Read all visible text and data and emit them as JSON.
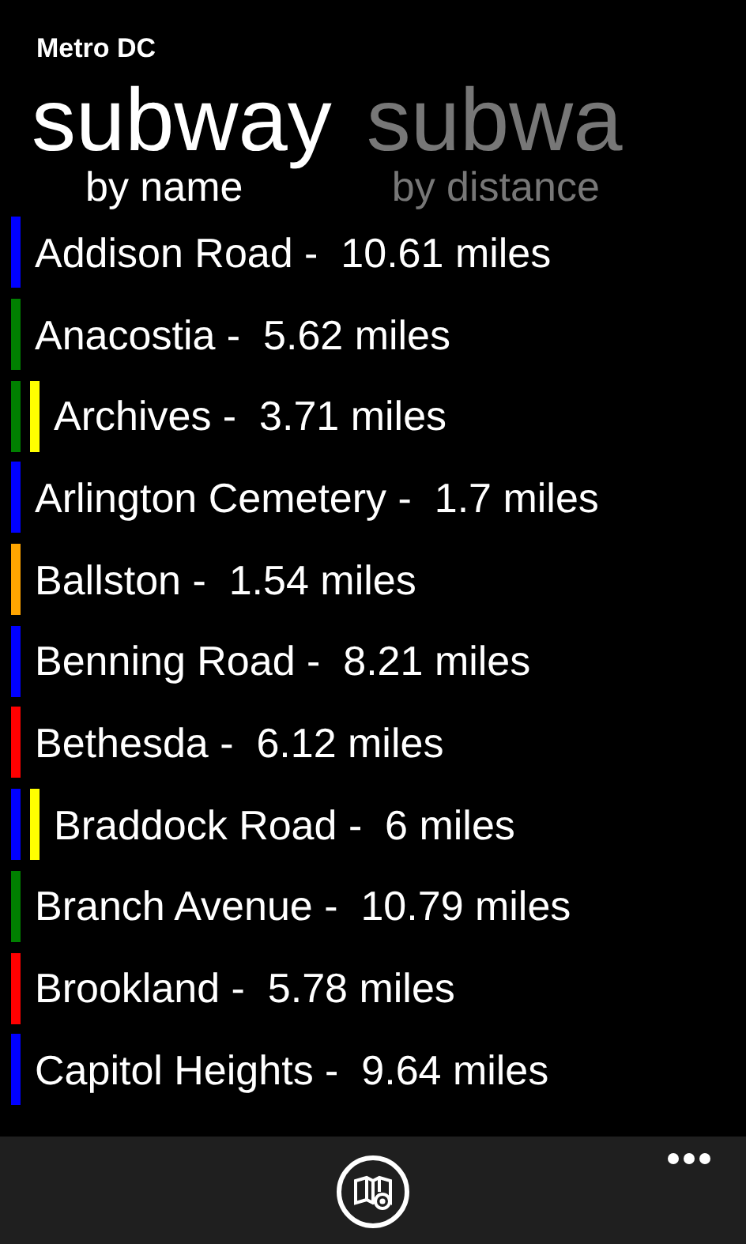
{
  "app_title": "Metro DC",
  "pivot": [
    {
      "title": "subway",
      "subtitle": "by name",
      "selected": true
    },
    {
      "title": "subwa",
      "subtitle": "by distance",
      "selected": false
    }
  ],
  "stations": [
    {
      "label": "Addison Road -  10.61 miles",
      "lines": [
        {
          "color": "#0000ff"
        }
      ]
    },
    {
      "label": "Anacostia -  5.62 miles",
      "lines": [
        {
          "color": "#008000"
        }
      ]
    },
    {
      "label": "Archives -  3.71 miles",
      "lines": [
        {
          "color": "#008000"
        },
        {
          "color": "#ffff00"
        }
      ]
    },
    {
      "label": "Arlington Cemetery -  1.7 miles",
      "lines": [
        {
          "color": "#0000ff"
        }
      ]
    },
    {
      "label": "Ballston -  1.54 miles",
      "lines": [
        {
          "color": "#ffa500"
        }
      ]
    },
    {
      "label": "Benning Road -  8.21 miles",
      "lines": [
        {
          "color": "#0000ff"
        }
      ]
    },
    {
      "label": "Bethesda -  6.12 miles",
      "lines": [
        {
          "color": "#ff0000"
        }
      ]
    },
    {
      "label": "Braddock Road -  6 miles",
      "lines": [
        {
          "color": "#0000ff"
        },
        {
          "color": "#ffff00"
        }
      ]
    },
    {
      "label": "Branch Avenue -  10.79 miles",
      "lines": [
        {
          "color": "#008000"
        }
      ]
    },
    {
      "label": "Brookland -  5.78 miles",
      "lines": [
        {
          "color": "#ff0000"
        }
      ]
    },
    {
      "label": "Capitol Heights -  9.64 miles",
      "lines": [
        {
          "color": "#0000ff"
        }
      ]
    }
  ]
}
